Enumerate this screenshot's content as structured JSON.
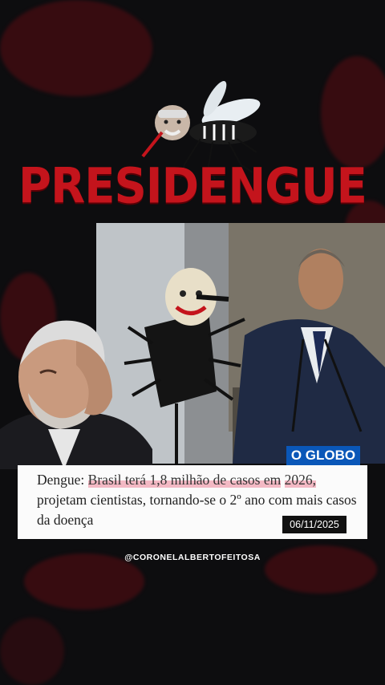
{
  "post": {
    "title": "PRESIDENGUE",
    "news_source": "O GLOBO",
    "headline_prefix": "Dengue: ",
    "headline_highlight_1": "Brasil terá 1,8 milhão de casos em",
    "headline_highlight_2": "2026,",
    "headline_rest": " projetam cientistas, tornando-se o 2º ano com mais casos da doença",
    "date": "06/11/2025",
    "handle": "@CORONELALBERTOFEITOSA"
  },
  "colors": {
    "background": "#0d0d0f",
    "title_red": "#c4141c",
    "highlight_pink": "#f3b9c4",
    "oglobo_blue": "#0a57b8"
  },
  "icons": [
    "mosquito-icon"
  ]
}
